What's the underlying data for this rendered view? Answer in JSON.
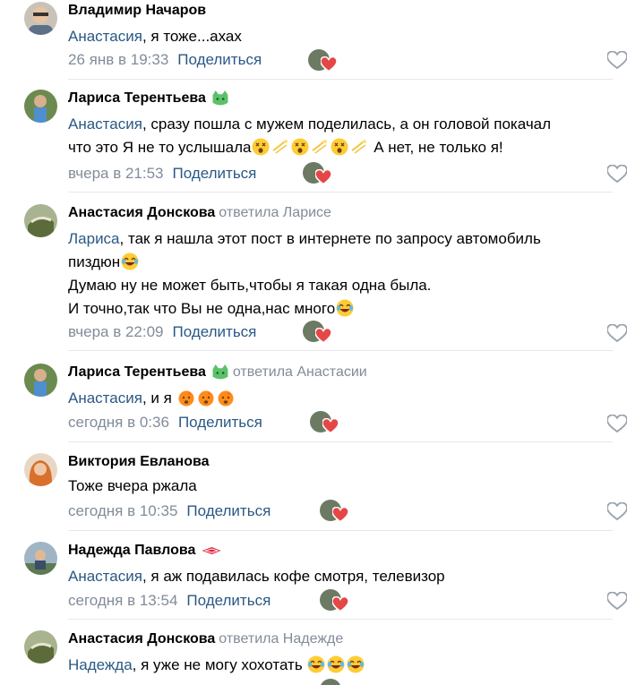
{
  "comments": [
    {
      "author": "Владимир Начаров",
      "reply_to": "",
      "mention": "Анастасия",
      "text_lines": [
        ", я тоже...ахах"
      ],
      "date": "26 янв в 19:33",
      "share": "Поделиться"
    },
    {
      "author": "Лариса Терентьева",
      "reply_to": "",
      "mention": "Анастасия",
      "text_line1": ", сразу пошла с мужем поделилась, а он головой покачал",
      "text_line2": "что это Я не то услышала",
      "text_line2_end": "А нет, не только я!",
      "date": "вчера в 21:53",
      "share": "Поделиться"
    },
    {
      "author": "Анастасия Донскова",
      "reply_to": "ответила Ларисе",
      "mention": "Лариса",
      "text_line1": ", так я нашла этот пост в интернете по запросу автомобиль",
      "text_line2": "пиздюн",
      "text_line3": "Думаю ну не может быть,чтобы я такая одна была.",
      "text_line4": "И точно,так что Вы не одна,нас много",
      "date": "вчера в 22:09",
      "share": "Поделиться"
    },
    {
      "author": "Лариса Терентьева",
      "reply_to": "ответила Анастасии",
      "mention": "Анастасия",
      "text_line1": ", и я",
      "date": "сегодня в 0:36",
      "share": "Поделиться"
    },
    {
      "author": "Виктория Евланова",
      "reply_to": "",
      "text_line1": "Тоже вчера ржала",
      "date": "сегодня в 10:35",
      "share": "Поделиться"
    },
    {
      "author": "Надежда Павлова",
      "reply_to": "",
      "mention": "Анастасия",
      "text_line1": ", я аж подавилась кофе смотря, телевизор",
      "date": "сегодня в 13:54",
      "share": "Поделиться"
    },
    {
      "author": "Анастасия Донскова",
      "reply_to": "ответила Надежде",
      "mention": "Надежда",
      "text_line1": ", я уже не могу хохотать"
    }
  ],
  "colors": {
    "link": "#2a5885",
    "muted": "#818c99",
    "heart": "#e64646"
  }
}
